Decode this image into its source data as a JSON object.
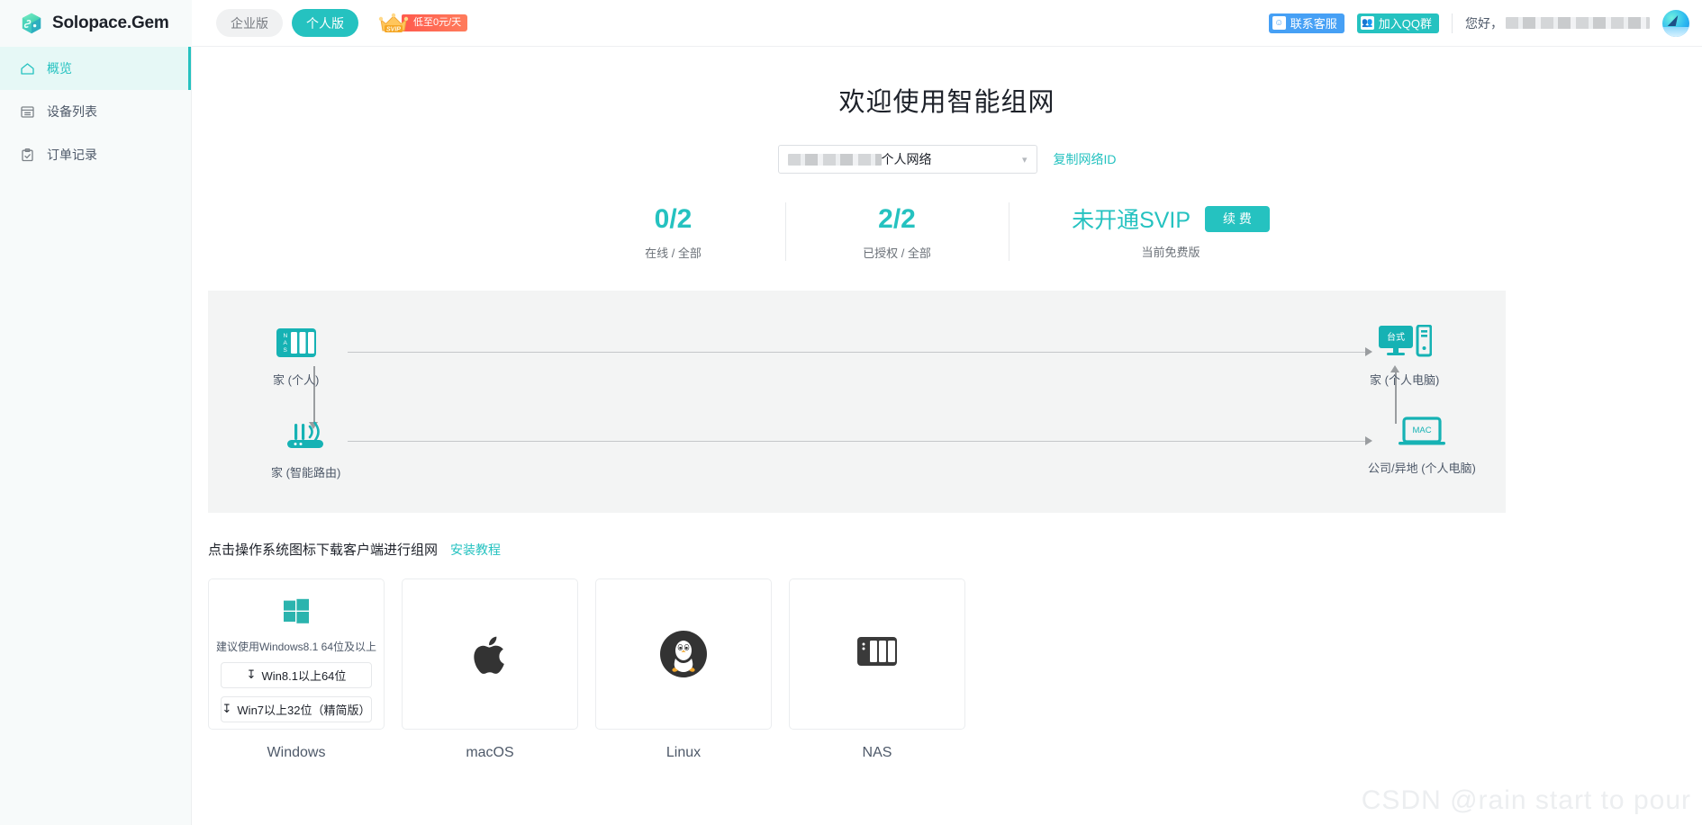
{
  "header": {
    "logo_text": "Solopace.Gem",
    "logo_icon": "cube-icon",
    "tabs": [
      {
        "label": "企业版",
        "active": false
      },
      {
        "label": "个人版",
        "active": true
      }
    ],
    "promo": {
      "crown_label": "SVIP",
      "tag_text": "低至0元/天"
    },
    "chips": [
      {
        "label": "联系客服",
        "icon": "headset-service-icon",
        "color": "#46a0f5"
      },
      {
        "label": "加入QQ群",
        "icon": "qq-group-icon",
        "color": "#25c2c0"
      }
    ],
    "greeting": "您好，",
    "username_redacted": true,
    "avatar_icon": "shark-avatar-icon"
  },
  "sidebar": {
    "items": [
      {
        "label": "概览",
        "icon": "home-icon",
        "active": true
      },
      {
        "label": "设备列表",
        "icon": "list-icon",
        "active": false
      },
      {
        "label": "订单记录",
        "icon": "clipboard-check-icon",
        "active": false
      }
    ]
  },
  "main": {
    "page_title": "欢迎使用智能组网",
    "network_select": {
      "value_suffix": "个人网络",
      "value_redacted": true,
      "caret_icon": "chevron-down-icon"
    },
    "copy_network_id": "复制网络ID",
    "stats": [
      {
        "value": "0/2",
        "label": "在线 / 全部"
      },
      {
        "value": "2/2",
        "label": "已授权 / 全部"
      }
    ],
    "svip": {
      "status": "未开通SVIP",
      "renew_label": "续 费",
      "sub_label": "当前免费版"
    },
    "diagram": {
      "nodes": [
        {
          "id": "nas",
          "icon": "nas-icon",
          "badge": "NAS",
          "caption": "家 (个人)"
        },
        {
          "id": "router",
          "icon": "router-wifi-icon",
          "badge": "",
          "caption": "家 (智能路由)"
        },
        {
          "id": "desktop",
          "icon": "desktop-icon",
          "badge": "台式",
          "caption": "家 (个人电脑)"
        },
        {
          "id": "mac",
          "icon": "laptop-icon",
          "badge": "MAC",
          "caption": "公司/异地 (个人电脑)"
        }
      ]
    },
    "download": {
      "title": "点击操作系统图标下载客户端进行组网",
      "tutorial_link": "安装教程",
      "cards": [
        {
          "os": "Windows",
          "icon": "windows-icon",
          "note": "建议使用Windows8.1 64位及以上",
          "buttons": [
            {
              "label": "Win8.1以上64位",
              "icon": "download-icon"
            },
            {
              "label": "Win7以上32位（精简版）",
              "icon": "download-icon"
            }
          ]
        },
        {
          "os": "macOS",
          "icon": "apple-icon",
          "note": "",
          "buttons": []
        },
        {
          "os": "Linux",
          "icon": "linux-tux-icon",
          "note": "",
          "buttons": []
        },
        {
          "os": "NAS",
          "icon": "nas-dark-icon",
          "note": "",
          "buttons": []
        }
      ]
    },
    "watermark": "CSDN @rain start to pour"
  },
  "colors": {
    "accent": "#25c2c0",
    "accent_soft": "#e6f8f6",
    "link_blue": "#46a0f5",
    "promo_red": "#ff5a4d",
    "text_primary": "#1d2129",
    "text_secondary": "#4e5969",
    "panel_bg": "#f3f4f4",
    "sidebar_bg": "#f7fafa"
  }
}
